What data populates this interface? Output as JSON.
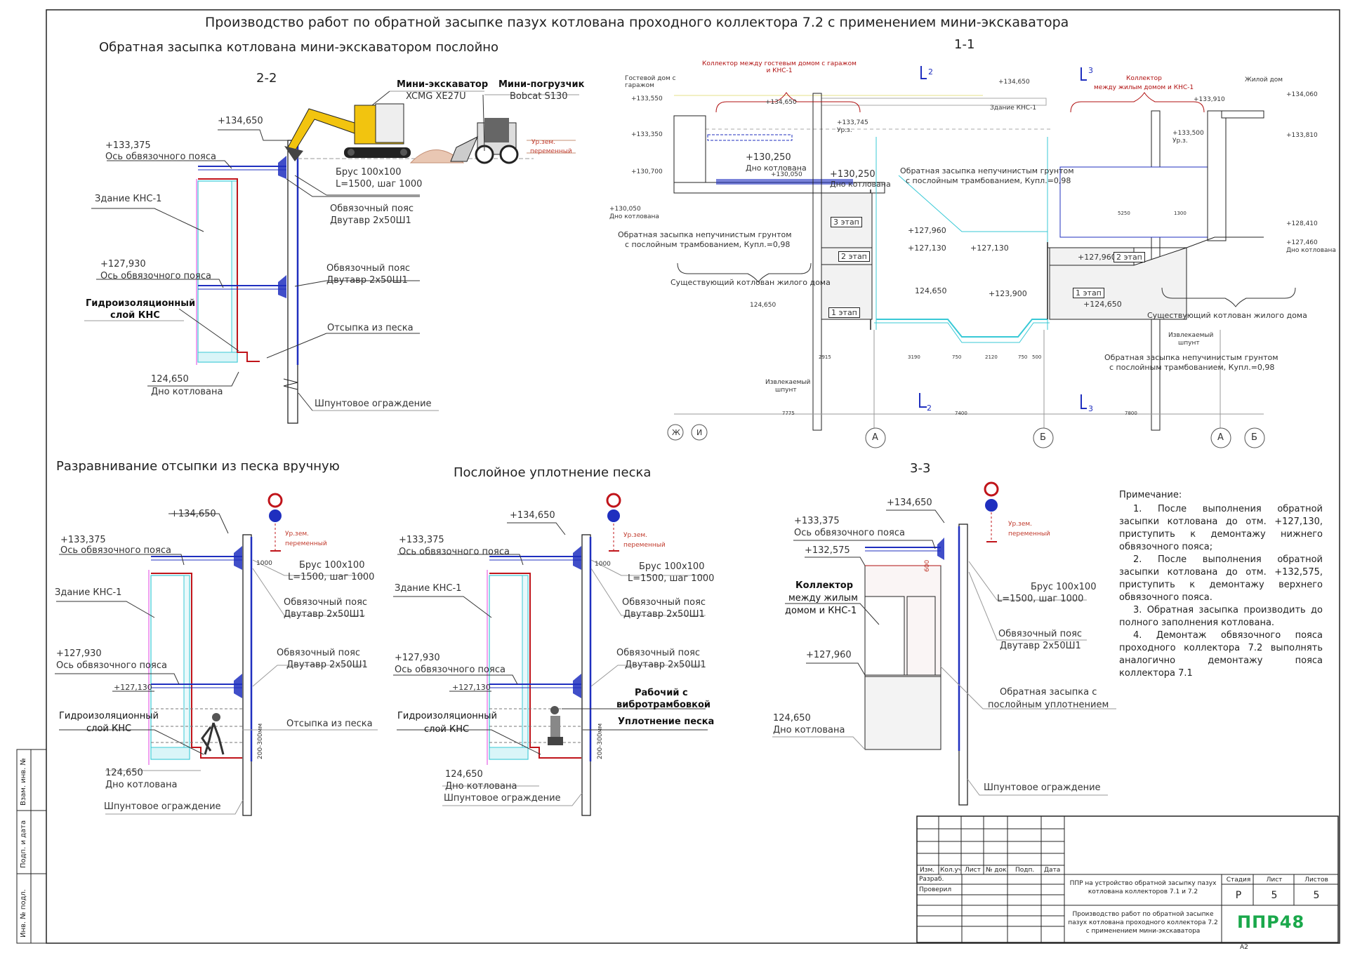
{
  "title": "Производство работ по обратной засыпке пазух котлована проходного коллектора 7.2 с применением мини-экскаватора",
  "sections": {
    "layer_backfill": "Обратная засыпка котлована мини-экскаватором послойно",
    "hand_leveling": "Разравнивание отсыпки из песка вручную",
    "compaction": "Послойное уплотнение песка",
    "cut_22": "2-2",
    "cut_11": "1-1",
    "cut_33": "3-3"
  },
  "s22": {
    "excavator": "Мини-экскаватор",
    "excavator_model": "XCMG XE27U",
    "loader": "Мини-погрузчик",
    "loader_model": "Bobcat S130",
    "ground_level": "Ур.зем.",
    "ground_level2": "переменный",
    "mark_top": "+134,650",
    "mark_belt1": "+133,375",
    "belt_axis": "Ось обвязочного пояса",
    "beam": "Брус 100х100",
    "beam_step": "L=1500, шаг 1000",
    "building": "Здание КНС-1",
    "belt": "Обвязочный пояс",
    "belt_profile": "Двутавр 2х50Ш1",
    "mark_belt2": "+127,930",
    "belt_axis2": "Ось обвязочного пояса",
    "belt2": "Обвязочный пояс",
    "belt_profile2": "Двутавр 2х50Ш1",
    "waterproof": "Гидроизоляционный",
    "waterproof2": "слой КНС",
    "sand": "Отсыпка из песка",
    "mark_bottom": "124,650",
    "pit_bottom": "Дно котлована",
    "sheet_pile": "Шпунтовое ограждение"
  },
  "s11": {
    "collector_a": "Коллектор между гостевым домом с гаражом и КНС-1",
    "collector_b": "Коллектор",
    "collector_b2": "между жилым домом и КНС-1",
    "guest_house": "Гостевой дом с гаражом",
    "living_house": "Жилой дом",
    "kns": "Здание КНС-1",
    "m1": "+133,550",
    "m2": "+133,350",
    "m3": "+130,700",
    "m4": "+130,050",
    "m4b": "Дно котлована",
    "m5": "+134,650",
    "m6": "+134,650",
    "m7": "+133,745",
    "m7b": "Ур.з.",
    "m8": "+130,250",
    "m8b": "Дно котлована",
    "m8c": "+130,050",
    "m9": "+130,250",
    "m9b": "Дно котлована",
    "m10": "+127,960",
    "m11": "+127,130",
    "m12": "+127,130",
    "m13": "124,650",
    "m14": "+123,900",
    "m15": "124,650",
    "m16": "+127,960",
    "m17": "+124,650",
    "m18": "+133,910",
    "m19": "+133,500",
    "m19b": "Ур.з.",
    "m20": "+134,060",
    "m21": "+133,810",
    "m22": "+128,410",
    "m23": "+127,460",
    "m23b": "Дно котлована",
    "stage3": "3 этап",
    "stage2": "2 этап",
    "stage1": "1 этап",
    "stage2b": "2 этап",
    "stage1b": "1 этап",
    "backfill_a": "Обратная засыпка непучинистым грунтом",
    "backfill_a2": "с послойным трамбованием, Купл.=0,98",
    "backfill_b": "Обратная засыпка непучинистым грунтом",
    "backfill_b2": "с послойным трамбованием, Купл.=0,98",
    "backfill_c": "Обратная засыпка непучинистым грунтом",
    "backfill_c2": "с послойным трамбованием, Купл.=0,98",
    "existing_pit": "Существующий котлован жилого дома",
    "existing_pit2": "Существующий котлован жилого дома",
    "extracted_pile": "Извлекаемый",
    "extracted_pile2": "шпунт",
    "extracted_pile3": "Извлекаемый",
    "extracted_pile4": "шпунт",
    "cut2": "2",
    "cut3": "3",
    "cut2b": "2",
    "cut3b": "3",
    "axis_zh": "Ж",
    "axis_i": "И",
    "axis_a": "А",
    "axis_b": "Б",
    "axis_a2": "А",
    "axis_b2": "Б",
    "d1": "7775",
    "d2": "7400",
    "d3": "7800",
    "d4": "2915",
    "d5": "3190",
    "d6": "750",
    "d7": "2120",
    "d8": "750",
    "d9": "500",
    "d10": "5250",
    "d11": "1300"
  },
  "s_hand": {
    "mark_top": "+134,650",
    "mark_belt1": "+133,375",
    "belt_axis": "Ось обвязочного пояса",
    "ground": "Ур.зем.",
    "ground2": "переменный",
    "dim1000": "1000",
    "beam": "Брус 100х100",
    "beam_step": "L=1500, шаг 1000",
    "building": "Здание КНС-1",
    "belt": "Обвязочный пояс",
    "belt_profile": "Двутавр 2х50Ш1",
    "mark_belt2": "+127,930",
    "belt_axis2": "Ось обвязочного пояса",
    "belt2": "Обвязочный пояс",
    "belt_profile2": "Двутавр 2х50Ш1",
    "mark_mid": "+127,130",
    "waterproof": "Гидроизоляционный",
    "waterproof2": "слой КНС",
    "sand": "Отсыпка из песка",
    "mark_bottom": "124,650",
    "pit_bottom": "Дно котлована",
    "sheet_pile": "Шпунтовое ограждение",
    "layer": "200-300мм"
  },
  "s_comp": {
    "mark_top": "+134,650",
    "mark_belt1": "+133,375",
    "belt_axis": "Ось обвязочного пояса",
    "ground": "Ур.зем.",
    "ground2": "переменный",
    "dim1000": "1000",
    "beam": "Брус 100х100",
    "beam_step": "L=1500, шаг 1000",
    "building": "Здание КНС-1",
    "belt": "Обвязочный пояс",
    "belt_profile": "Двутавр 2х50Ш1",
    "mark_belt2": "+127,930",
    "belt_axis2": "Ось обвязочного пояса",
    "belt2": "Обвязочный пояс",
    "belt_profile2": "Двутавр 2х50Ш1",
    "mark_mid": "+127,130",
    "worker": "Рабочий с",
    "worker2": "вибротрамбовкой",
    "compaction": "Уплотнение песка",
    "waterproof": "Гидроизоляционный",
    "waterproof2": "слой КНС",
    "mark_bottom": "124,650",
    "pit_bottom": "Дно котлована",
    "sheet_pile": "Шпунтовое ограждение",
    "layer": "200-300мм"
  },
  "s33": {
    "mark_top": "+134,650",
    "mark_belt1": "+133,375",
    "belt_axis": "Ось обвязочного пояса",
    "mark_132": "+132,575",
    "ground": "Ур.зем.",
    "ground2": "переменный",
    "collector": "Коллектор",
    "collector2": "между жилым",
    "collector3": "домом и КНС-1",
    "beam": "Брус 100х100",
    "beam_step": "L=1500, шаг 1000",
    "belt": "Обвязочный пояс",
    "belt_profile": "Двутавр 2х50Ш1",
    "mark_127": "+127,960",
    "backfill": "Обратная засыпка с",
    "backfill2": "послойным уплотнением",
    "mark_bottom": "124,650",
    "pit_bottom": "Дно котлована",
    "sheet_pile": "Шпунтовое ограждение",
    "dim": "600"
  },
  "notes": {
    "title": "Примечание:",
    "n1": "1. После выполнения обратной засыпки котлована до отм. +127,130, приступить к демонтажу нижнего обвязочного пояса;",
    "n2": "2. После выполнения обратной засыпки котлована до отм. +132,575, приступить к демонтажу верхнего обвязочного пояса.",
    "n3": "3. Обратная засыпка производить до полного заполнения котлована.",
    "n4": "4. Демонтаж обвязочного пояса проходного коллектора 7.2 выполнять аналогично демонтажу пояса коллектора 7.1"
  },
  "stamp": {
    "c1": "Изм.",
    "c2": "Кол.уч",
    "c3": "Лист",
    "c4": "№ док.",
    "c5": "Подп.",
    "c6": "Дата",
    "r1": "Разраб.",
    "r2": "Проверил",
    "project": "ППР на устройство обратной засыпку пазух котлована коллекторов 7.1 и 7.2",
    "sheet_title": "Производство работ по обратной засыпке пазух котлована проходного коллектора 7.2 с применением мини-экскаватора",
    "stage_h": "Стадия",
    "sheet_h": "Лист",
    "sheets_h": "Листов",
    "stage": "Р",
    "sheet": "5",
    "sheets": "5",
    "company": "ППР48",
    "format": "А2"
  },
  "side": {
    "s1": "Взам. инв. №",
    "s2": "Подп. и дата",
    "s3": "Инв. № подл."
  },
  "colors": {
    "blue": "#1f2fbf",
    "cyan": "#38c9d6",
    "red": "#c0141a",
    "magenta": "#e040e0",
    "yellow": "#e6b800",
    "green": "#1aa84b",
    "darkred": "#b01010"
  }
}
